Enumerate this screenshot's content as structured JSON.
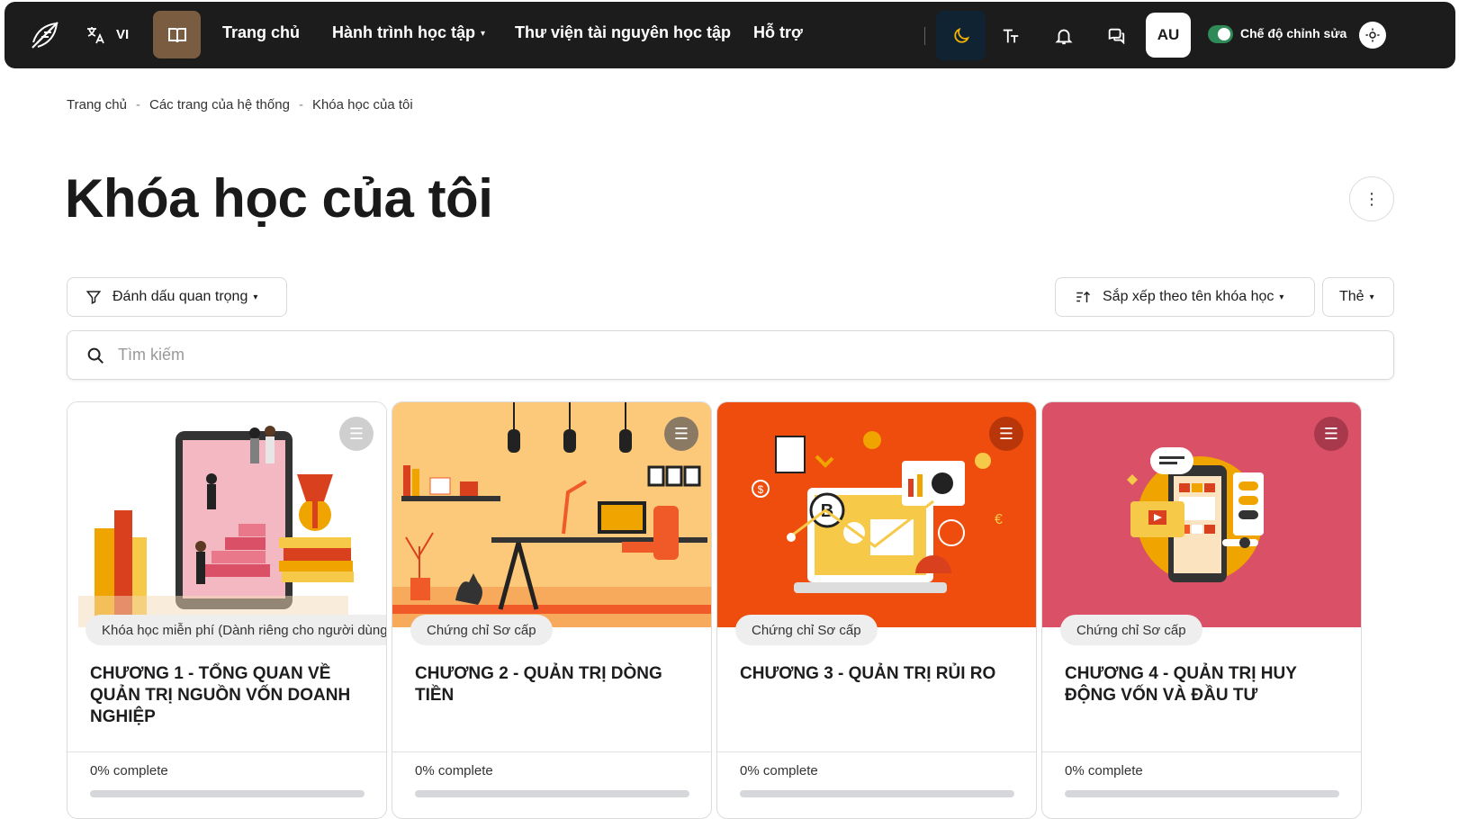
{
  "header": {
    "language": "VI",
    "nav": [
      {
        "label": "Trang chủ",
        "has_dropdown": false
      },
      {
        "label": "Hành trình học tập",
        "has_dropdown": true
      },
      {
        "label": "Thư viện tài nguyên học tập",
        "has_dropdown": false
      },
      {
        "label": "Hỗ trợ",
        "has_dropdown": false
      }
    ],
    "avatar_initials": "AU",
    "edit_mode_label": "Chế độ chỉnh sửa",
    "edit_mode_on": true,
    "icons": [
      "logo-icon",
      "translate-icon",
      "book-icon",
      "moon-icon",
      "text-format-icon",
      "bell-icon",
      "chat-icon",
      "accessibility-icon"
    ]
  },
  "breadcrumb": [
    "Trang chủ",
    "Các trang của hệ thống",
    "Khóa học của tôi"
  ],
  "page_title": "Khóa học của tôi",
  "filters": {
    "filter_label": "Đánh dấu quan trọng",
    "sort_label": "Sắp xếp theo tên khóa học",
    "view_label": "Thẻ"
  },
  "search": {
    "placeholder": "Tìm kiếm",
    "value": ""
  },
  "courses": [
    {
      "tag": "Khóa học miễn phí (Dành riêng cho người dùng C",
      "title": "CHƯƠNG 1 - TỔNG QUAN VỀ QUẢN TRỊ NGUỒN VỐN DOANH NGHIỆP",
      "progress_text": "0% complete",
      "progress": 0,
      "image_bg": "#ffffff",
      "menu_color": "#cfcfcf"
    },
    {
      "tag": "Chứng chỉ Sơ cấp",
      "title": "CHƯƠNG 2 - QUẢN TRỊ DÒNG TIỀN",
      "progress_text": "0% complete",
      "progress": 0,
      "image_bg": "#fcc87a",
      "menu_color": "#8a7a64"
    },
    {
      "tag": "Chứng chỉ Sơ cấp",
      "title": "CHƯƠNG 3 - QUẢN TRỊ RỦI RO",
      "progress_text": "0% complete",
      "progress": 0,
      "image_bg": "#ef4d0e",
      "menu_color": "#b8360a"
    },
    {
      "tag": "Chứng chỉ Sơ cấp",
      "title": "CHƯƠNG 4 - QUẢN TRỊ HUY ĐỘNG VỐN VÀ ĐẦU TƯ",
      "progress_text": "0% complete",
      "progress": 0,
      "image_bg": "#d95067",
      "menu_color": "#a8384c"
    }
  ],
  "colors": {
    "topbar": "#1c1c1c",
    "book_button": "#7a5c40",
    "dark_toggle_bg": "#0f2333",
    "toggle_on": "#2e8b57"
  }
}
